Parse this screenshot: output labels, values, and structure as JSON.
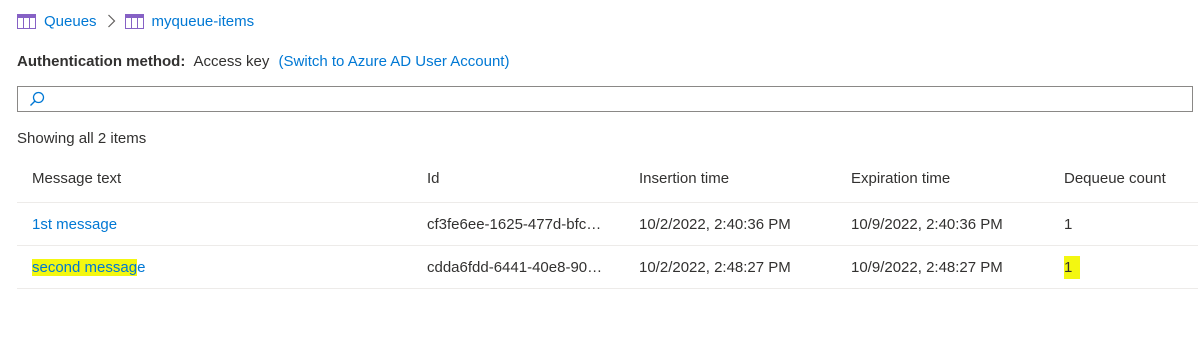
{
  "breadcrumb": {
    "items": [
      {
        "label": "Queues",
        "icon": "queue-table-icon"
      },
      {
        "label": "myqueue-items",
        "icon": "queue-table-icon"
      }
    ],
    "separator_icon": "chevron-right-icon"
  },
  "auth": {
    "label": "Authentication method:",
    "value": "Access key",
    "switch_link": "(Switch to Azure AD User Account)"
  },
  "search": {
    "placeholder": "",
    "value": "",
    "icon": "search-icon"
  },
  "summary": "Showing all 2 items",
  "table": {
    "columns": [
      "Message text",
      "Id",
      "Insertion time",
      "Expiration time",
      "Dequeue count"
    ],
    "rows": [
      {
        "message_text": "1st message",
        "id": "cf3fe6ee-1625-477d-bfc…",
        "insertion_time": "10/2/2022, 2:40:36 PM",
        "expiration_time": "10/9/2022, 2:40:36 PM",
        "dequeue_count": "1"
      },
      {
        "message_text_highlighted": "second messag",
        "message_text_rest": "e",
        "id": "cdda6fdd-6441-40e8-90…",
        "insertion_time": "10/2/2022, 2:48:27 PM",
        "expiration_time": "10/9/2022, 2:48:27 PM",
        "dequeue_count": "1"
      }
    ]
  },
  "colors": {
    "link": "#0078d4",
    "highlight": "#f3f711",
    "icon_purple": "#8661c5",
    "divider": "#edebe9"
  }
}
